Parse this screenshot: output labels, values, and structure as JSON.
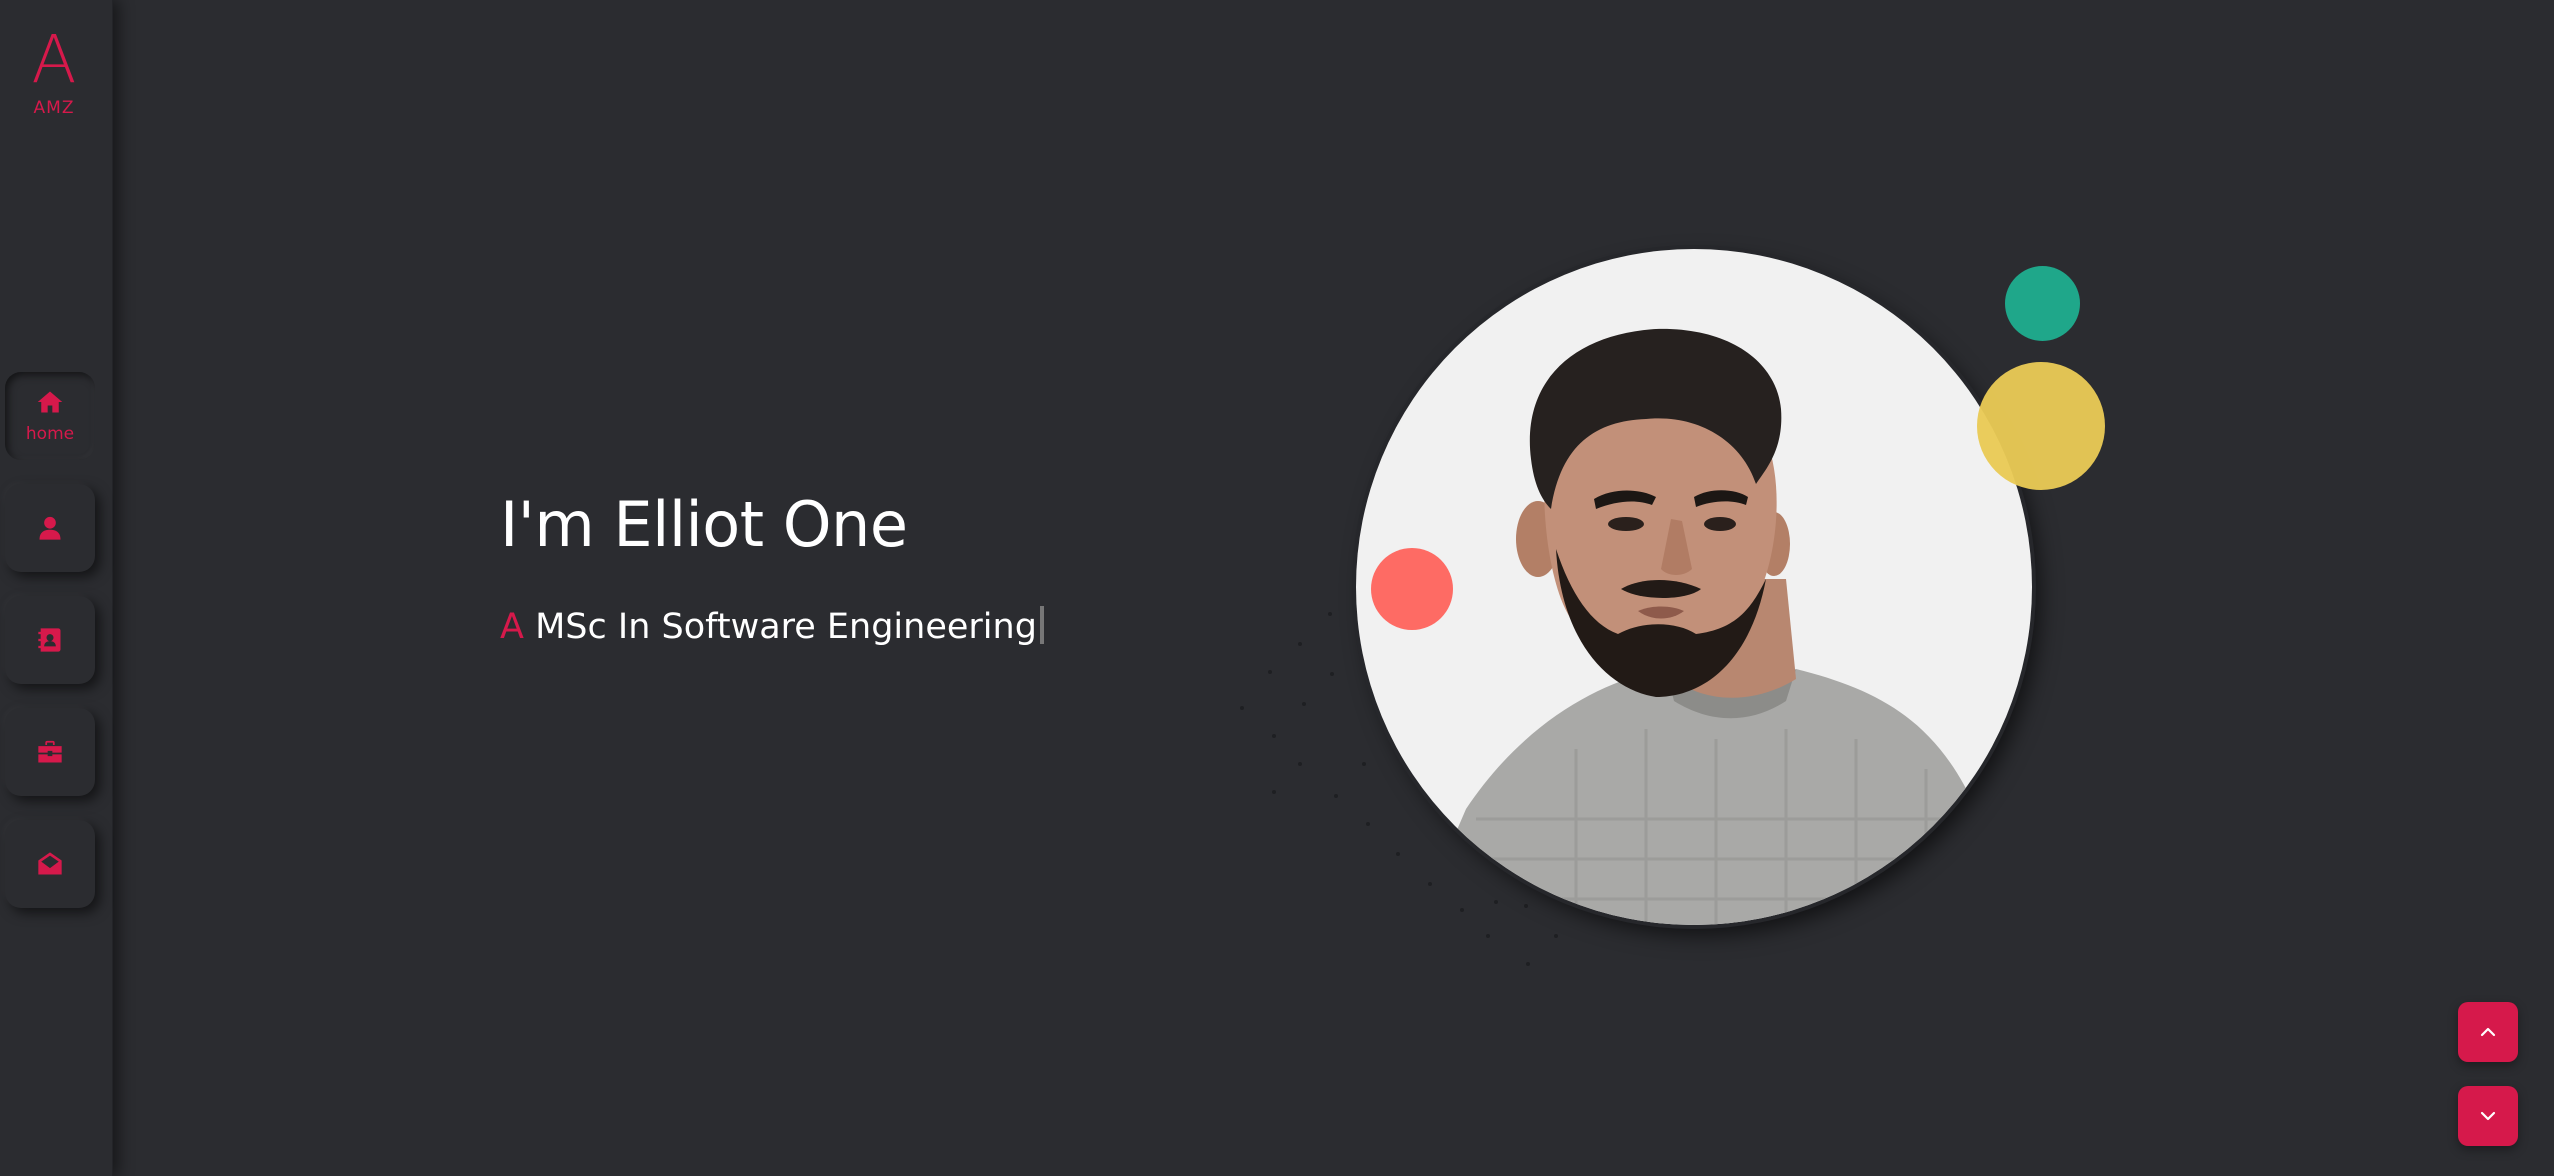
{
  "colors": {
    "accent": "#d6194b",
    "background": "#2b2c30",
    "teal": "#1fa78a",
    "yellow": "#e9ca55",
    "coral": "#fe6b64"
  },
  "logo": {
    "letter": "A",
    "subtitle": "AMZ"
  },
  "nav": {
    "items": [
      {
        "icon": "home-icon",
        "label": "home",
        "active": true
      },
      {
        "icon": "user-icon",
        "label": "",
        "active": false
      },
      {
        "icon": "address-book-icon",
        "label": "",
        "active": false
      },
      {
        "icon": "briefcase-icon",
        "label": "",
        "active": false
      },
      {
        "icon": "envelope-open-icon",
        "label": "",
        "active": false
      }
    ]
  },
  "hero": {
    "name": "I'm Elliot One",
    "subtitle_prefix": "A",
    "subtitle_text": "MSc In Software Engineering"
  },
  "profile": {
    "photo": "profile-photo"
  },
  "scroll": {
    "up_icon": "chevron-up-icon",
    "down_icon": "chevron-down-icon"
  }
}
